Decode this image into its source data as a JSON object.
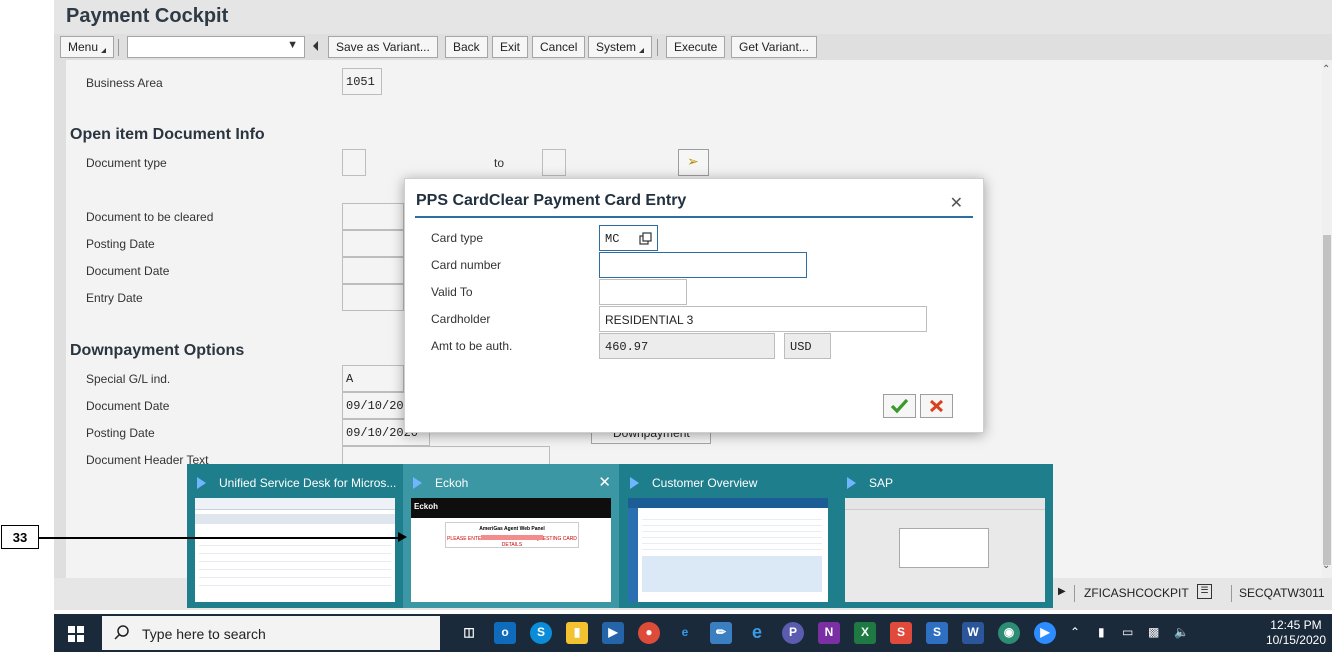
{
  "sap": {
    "title": "Payment Cockpit",
    "toolbar": {
      "menu": "Menu",
      "save_variant": "Save as Variant...",
      "back": "Back",
      "exit": "Exit",
      "cancel": "Cancel",
      "system": "System",
      "execute": "Execute",
      "get_variant": "Get Variant..."
    },
    "form": {
      "business_area_label": "Business Area",
      "business_area_value": "1051",
      "open_item_section": "Open item Document Info",
      "document_type_label": "Document type",
      "to_label": "to",
      "doc_to_be_cleared_label": "Document to be cleared",
      "posting_date_label": "Posting Date",
      "document_date_label": "Document Date",
      "entry_date_label": "Entry Date",
      "downpayment_section": "Downpayment Options",
      "special_gl_label": "Special G/L ind.",
      "special_gl_value": "A",
      "dp_document_date_label": "Document Date",
      "dp_document_date_value": "09/10/2020",
      "dp_posting_date_label": "Posting Date",
      "dp_posting_date_value": "09/10/2020",
      "downpayment_button": "Downpayment",
      "doc_header_text_label": "Document Header Text"
    },
    "status": {
      "transaction": "ZFICASHCOCKPIT",
      "server": "SECQATW3011"
    }
  },
  "dialog": {
    "title": "PPS CardClear Payment Card Entry",
    "card_type_label": "Card type",
    "card_type_value": "MC",
    "card_number_label": "Card number",
    "card_number_value": "",
    "valid_to_label": "Valid To",
    "valid_to_value": "",
    "cardholder_label": "Cardholder",
    "cardholder_value": "RESIDENTIAL 3",
    "amount_label": "Amt to be auth.",
    "amount_value": "460.97",
    "currency_value": "USD"
  },
  "preview": {
    "tiles": [
      {
        "title": "Unified Service Desk for Micros..."
      },
      {
        "title": "Eckoh"
      },
      {
        "title": "Customer Overview"
      },
      {
        "title": "SAP"
      }
    ],
    "eckoh_brand": "Eckoh",
    "eckoh_panel_title": "AmeriGas Agent Web Panel",
    "eckoh_warning": "PLEASE ENTER CALL ID BEFORE REQUESTING CARD DETAILS"
  },
  "callout": {
    "number": "33"
  },
  "taskbar": {
    "search_placeholder": "Type here to search",
    "time": "12:45 PM",
    "date": "10/15/2020"
  }
}
